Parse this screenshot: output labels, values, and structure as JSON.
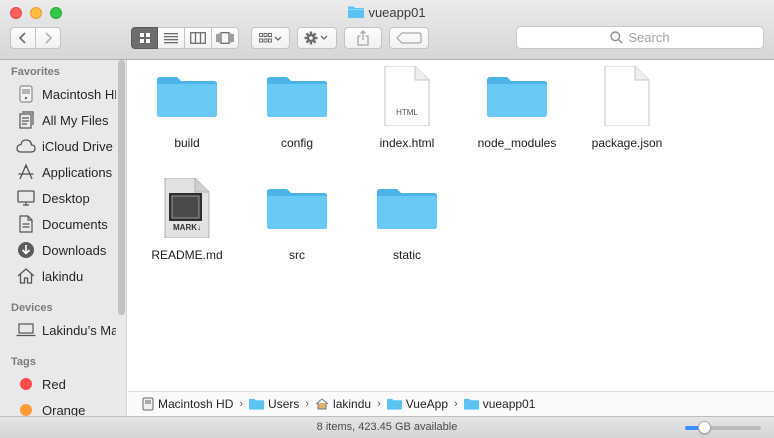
{
  "window": {
    "title": "vueapp01"
  },
  "toolbar": {
    "search_placeholder": "Search",
    "view_modes": [
      "icon",
      "list",
      "column",
      "cover-flow"
    ],
    "active_view": "icon"
  },
  "sidebar": {
    "favorites_heading": "Favorites",
    "favorites": [
      {
        "label": "Macintosh HD",
        "icon": "hard-drive-icon"
      },
      {
        "label": "All My Files",
        "icon": "all-files-icon"
      },
      {
        "label": "iCloud Drive",
        "icon": "cloud-icon"
      },
      {
        "label": "Applications",
        "icon": "applications-icon"
      },
      {
        "label": "Desktop",
        "icon": "desktop-icon"
      },
      {
        "label": "Documents",
        "icon": "documents-icon"
      },
      {
        "label": "Downloads",
        "icon": "downloads-icon"
      },
      {
        "label": "lakindu",
        "icon": "home-icon"
      }
    ],
    "devices_heading": "Devices",
    "devices": [
      {
        "label": "Lakindu’s MacBook",
        "icon": "laptop-icon"
      }
    ],
    "tags_heading": "Tags",
    "tags": [
      {
        "label": "Red",
        "color": "#fc4d4a"
      },
      {
        "label": "Orange",
        "color": "#fd9a38"
      }
    ]
  },
  "files": [
    {
      "name": "build",
      "type": "folder"
    },
    {
      "name": "config",
      "type": "folder"
    },
    {
      "name": "index.html",
      "type": "html",
      "badge": "HTML"
    },
    {
      "name": "node_modules",
      "type": "folder"
    },
    {
      "name": "package.json",
      "type": "document"
    },
    {
      "name": "README.md",
      "type": "markdown",
      "badge": "MARK↓"
    },
    {
      "name": "src",
      "type": "folder"
    },
    {
      "name": "static",
      "type": "folder"
    }
  ],
  "pathbar": {
    "crumbs": [
      {
        "label": "Macintosh HD",
        "icon": "hard-drive-icon"
      },
      {
        "label": "Users",
        "icon": "folder-icon"
      },
      {
        "label": "lakindu",
        "icon": "home-icon"
      },
      {
        "label": "VueApp",
        "icon": "folder-icon"
      },
      {
        "label": "vueapp01",
        "icon": "folder-icon"
      }
    ]
  },
  "status": {
    "text": "8 items, 423.45 GB available",
    "icon_size_level": 0.25
  },
  "colors": {
    "folder": "#5bc2f2",
    "accent": "#3e8ef7"
  }
}
